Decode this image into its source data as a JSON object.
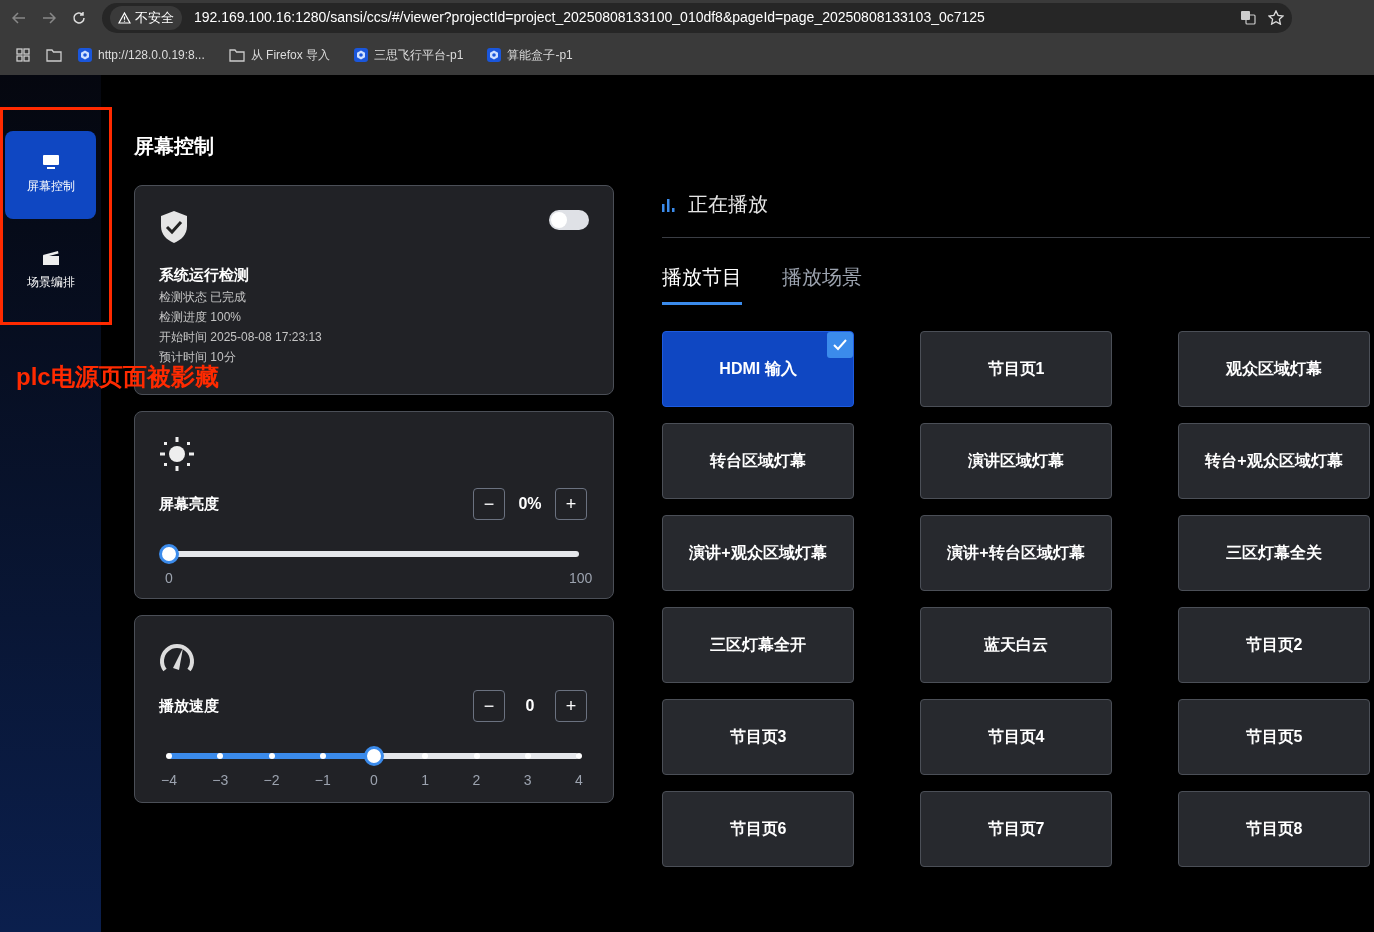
{
  "browser": {
    "security_label": "不安全",
    "url": "192.169.100.16:1280/sansi/ccs/#/viewer?projectId=project_20250808133100_010df8&pageId=page_20250808133103_0c7125",
    "bookmarks": [
      {
        "kind": "site",
        "label": "http://128.0.0.19:8..."
      },
      {
        "kind": "folder",
        "label": "从 Firefox 导入"
      },
      {
        "kind": "site",
        "label": "三思飞行平台-p1"
      },
      {
        "kind": "site",
        "label": "算能盒子-p1"
      }
    ]
  },
  "sidebar": {
    "items": [
      {
        "kind": "screen",
        "label": "屏幕控制",
        "selected": true
      },
      {
        "kind": "scene",
        "label": "场景编排",
        "selected": false
      }
    ]
  },
  "annotation": {
    "text": "plc电源页面被影藏"
  },
  "page_title": "屏幕控制",
  "detection": {
    "on": false,
    "title": "系统运行检测",
    "lines": [
      "检测状态 已完成",
      "检测进度 100%",
      "开始时间 2025-08-08 17:23:13",
      "预计时间 10分"
    ]
  },
  "brightness": {
    "label": "屏幕亮度",
    "minus": "−",
    "value": "0%",
    "plus": "+",
    "level": 0,
    "ticks": [
      "0",
      "100"
    ]
  },
  "speed": {
    "label": "播放速度",
    "minus": "−",
    "value": "0",
    "plus": "+",
    "level": 0.5,
    "ticks": [
      "−4",
      "−3",
      "−2",
      "−1",
      "0",
      "1",
      "2",
      "3",
      "4"
    ]
  },
  "now_playing": {
    "title": "正在播放"
  },
  "tabs": [
    {
      "label": "播放节目",
      "selected": true
    },
    {
      "label": "播放场景",
      "selected": false
    }
  ],
  "programs": [
    {
      "label": "HDMI 输入",
      "selected": true
    },
    {
      "label": "节目页1",
      "selected": false
    },
    {
      "label": "观众区域灯幕",
      "selected": false
    },
    {
      "label": "转台区域灯幕",
      "selected": false
    },
    {
      "label": "演讲区域灯幕",
      "selected": false
    },
    {
      "label": "转台+观众区域灯幕",
      "selected": false
    },
    {
      "label": "演讲+观众区域灯幕",
      "selected": false
    },
    {
      "label": "演讲+转台区域灯幕",
      "selected": false
    },
    {
      "label": "三区灯幕全关",
      "selected": false
    },
    {
      "label": "三区灯幕全开",
      "selected": false
    },
    {
      "label": "蓝天白云",
      "selected": false
    },
    {
      "label": "节目页2",
      "selected": false
    },
    {
      "label": "节目页3",
      "selected": false
    },
    {
      "label": "节目页4",
      "selected": false
    },
    {
      "label": "节目页5",
      "selected": false
    },
    {
      "label": "节目页6",
      "selected": false
    },
    {
      "label": "节目页7",
      "selected": false
    },
    {
      "label": "节目页8",
      "selected": false
    }
  ]
}
